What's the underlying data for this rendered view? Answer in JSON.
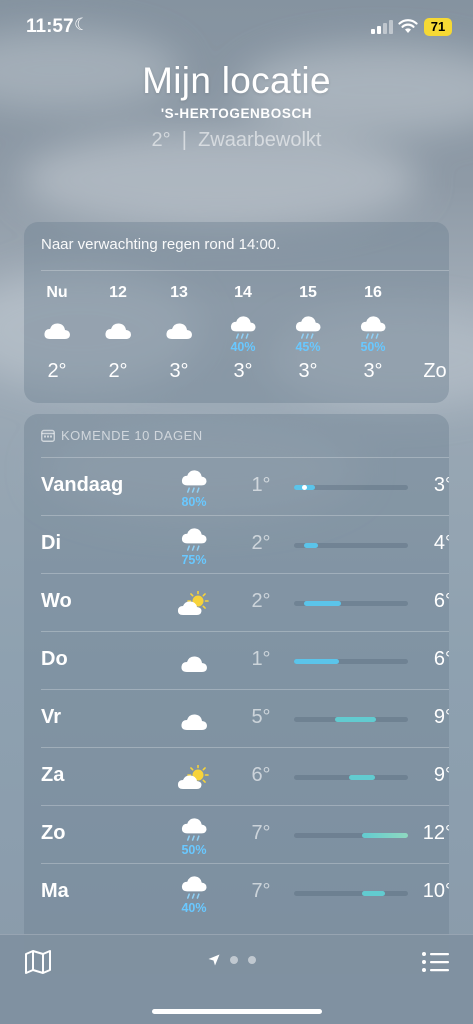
{
  "status_bar": {
    "time": "11:57",
    "battery": "71"
  },
  "location": {
    "title": "Mijn locatie",
    "city": "'S-HERTOGENBOSCH",
    "current_temp": "2°",
    "separator": "|",
    "condition": "Zwaarbewolkt"
  },
  "hourly": {
    "summary": "Naar verwachting regen rond 14:00.",
    "items": [
      {
        "label": "Nu",
        "icon": "cloud-icon",
        "precip": "",
        "temp": "2°"
      },
      {
        "label": "12",
        "icon": "cloud-icon",
        "precip": "",
        "temp": "2°"
      },
      {
        "label": "13",
        "icon": "cloud-icon",
        "precip": "",
        "temp": "3°"
      },
      {
        "label": "14",
        "icon": "rain-cloud-icon",
        "precip": "40%",
        "temp": "3°"
      },
      {
        "label": "15",
        "icon": "rain-cloud-icon",
        "precip": "45%",
        "temp": "3°"
      },
      {
        "label": "16",
        "icon": "rain-cloud-icon",
        "precip": "50%",
        "temp": "3°"
      },
      {
        "label": "",
        "icon": "",
        "precip": "",
        "temp": "Zo"
      }
    ]
  },
  "daily": {
    "header": "KOMENDE 10 DAGEN",
    "range_min": 1,
    "range_max": 12,
    "rows": [
      {
        "day": "Vandaag",
        "icon": "rain-cloud-icon",
        "precip": "80%",
        "low": "1°",
        "high": "3°",
        "low_val": 1,
        "high_val": 3,
        "current_val": 2
      },
      {
        "day": "Di",
        "icon": "rain-cloud-icon",
        "precip": "75%",
        "low": "2°",
        "high": "4°",
        "low_val": 2,
        "high_val": 3.3
      },
      {
        "day": "Wo",
        "icon": "partly-cloudy-icon",
        "precip": "",
        "low": "2°",
        "high": "6°",
        "low_val": 2,
        "high_val": 5.5
      },
      {
        "day": "Do",
        "icon": "cloud-icon",
        "precip": "",
        "low": "1°",
        "high": "6°",
        "low_val": 1,
        "high_val": 5.3
      },
      {
        "day": "Vr",
        "icon": "cloud-icon",
        "precip": "",
        "low": "5°",
        "high": "9°",
        "low_val": 5,
        "high_val": 8.9
      },
      {
        "day": "Za",
        "icon": "partly-cloudy-icon",
        "precip": "",
        "low": "6°",
        "high": "9°",
        "low_val": 6.3,
        "high_val": 8.8
      },
      {
        "day": "Zo",
        "icon": "rain-cloud-icon",
        "precip": "50%",
        "low": "7°",
        "high": "12°",
        "low_val": 7.6,
        "high_val": 12
      },
      {
        "day": "Ma",
        "icon": "rain-cloud-icon",
        "precip": "40%",
        "low": "7°",
        "high": "10°",
        "low_val": 7.6,
        "high_val": 9.8
      }
    ]
  },
  "colors": {
    "precip_text": "#69c8ff",
    "bar_cool": "#5bc4ea",
    "bar_mild": "#62cbd0",
    "bar_warm": "#8fd8c0",
    "battery": "#f6d934"
  },
  "toolbar": {
    "pages": 2
  }
}
